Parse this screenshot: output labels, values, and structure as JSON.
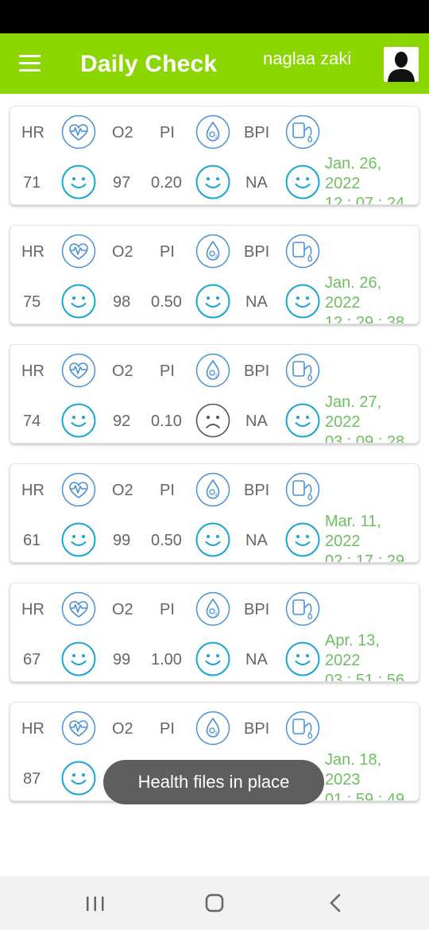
{
  "app": {
    "title": "Daily Check",
    "user_name": "naglaa zaki"
  },
  "labels": {
    "hr": "HR",
    "o2": "O2",
    "pi": "PI",
    "bpi": "BPI"
  },
  "colors": {
    "accent": "#8cd600",
    "icon_blue": "#4a90d9",
    "icon_teal": "#16a6d6",
    "date_green": "#6fbf5f",
    "sad_gray": "#555555"
  },
  "records": [
    {
      "hr": "71",
      "o2": "97",
      "pi": "0.20",
      "bpi": "NA",
      "o2_status": "happy",
      "pi_status": "happy",
      "bpi_status": "happy",
      "date_line1": "Jan. 26,",
      "date_line2": "2022",
      "time": "12 : 07 : 24"
    },
    {
      "hr": "75",
      "o2": "98",
      "pi": "0.50",
      "bpi": "NA",
      "o2_status": "happy",
      "pi_status": "happy",
      "bpi_status": "happy",
      "date_line1": "Jan. 26,",
      "date_line2": "2022",
      "time": "12 : 29 : 38"
    },
    {
      "hr": "74",
      "o2": "92",
      "pi": "0.10",
      "bpi": "NA",
      "o2_status": "happy",
      "pi_status": "sad",
      "bpi_status": "happy",
      "date_line1": "Jan. 27,",
      "date_line2": "2022",
      "time": "03 : 09 : 28"
    },
    {
      "hr": "61",
      "o2": "99",
      "pi": "0.50",
      "bpi": "NA",
      "o2_status": "happy",
      "pi_status": "happy",
      "bpi_status": "happy",
      "date_line1": "Mar. 11,",
      "date_line2": "2022",
      "time": "02 : 17 : 29"
    },
    {
      "hr": "67",
      "o2": "99",
      "pi": "1.00",
      "bpi": "NA",
      "o2_status": "happy",
      "pi_status": "happy",
      "bpi_status": "happy",
      "date_line1": "Apr. 13,",
      "date_line2": "2022",
      "time": "03 : 51 : 56"
    },
    {
      "hr": "87",
      "o2": "",
      "pi": "",
      "bpi": "",
      "o2_status": "happy",
      "pi_status": "hidden",
      "bpi_status": "hidden",
      "date_line1": "Jan. 18,",
      "date_line2": "2023",
      "time": "01 : 59 : 49"
    }
  ],
  "toast": {
    "message": "Health files in place"
  },
  "icons": {
    "menu": "hamburger-icon",
    "avatar": "person-avatar-icon",
    "heart": "heart-pulse-icon",
    "drop": "oxygen-drop-icon",
    "bp": "blood-pressure-icon",
    "happy": "smiley-icon",
    "sad": "sad-face-icon",
    "recents": "recents-icon",
    "home": "home-icon",
    "back": "back-icon"
  }
}
